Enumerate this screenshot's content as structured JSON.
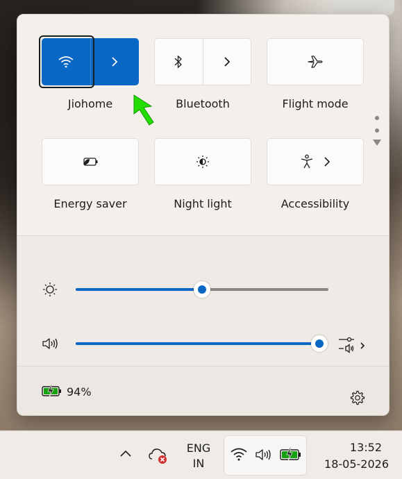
{
  "quick_settings": {
    "tiles": [
      {
        "label": "Jiohome",
        "icon": "wifi-icon",
        "active": true
      },
      {
        "label": "Bluetooth",
        "icon": "bluetooth-icon",
        "active": false
      },
      {
        "label": "Flight mode",
        "icon": "airplane-icon",
        "active": false
      },
      {
        "label": "Energy saver",
        "icon": "energy-saver-icon",
        "active": false
      },
      {
        "label": "Night light",
        "icon": "night-light-icon",
        "active": false
      },
      {
        "label": "Accessibility",
        "icon": "accessibility-icon",
        "active": false
      }
    ],
    "brightness": {
      "icon": "brightness-icon",
      "level": 0.5
    },
    "volume": {
      "icon": "speaker-icon",
      "level": 1.0
    },
    "battery": {
      "percent_text": "94%",
      "icon": "battery-charging-icon"
    },
    "accent_color": "#0a67c3"
  },
  "taskbar": {
    "language_line1": "ENG",
    "language_line2": "IN",
    "time": "13:52",
    "date": "18-05-2026"
  }
}
